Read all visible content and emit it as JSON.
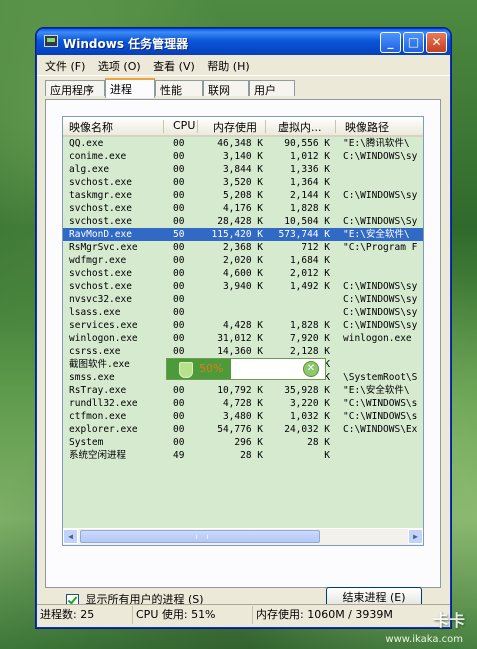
{
  "window": {
    "title": "Windows 任务管理器",
    "buttons": {
      "minimize": "_",
      "maximize": "□",
      "close": "✕"
    }
  },
  "menu": [
    {
      "label": "文件 (F)"
    },
    {
      "label": "选项 (O)"
    },
    {
      "label": "查看 (V)"
    },
    {
      "label": "帮助 (H)"
    }
  ],
  "tabs": [
    {
      "label": "应用程序",
      "active": false
    },
    {
      "label": "进程",
      "active": true
    },
    {
      "label": "性能",
      "active": false
    },
    {
      "label": "联网",
      "active": false
    },
    {
      "label": "用户",
      "active": false
    }
  ],
  "table": {
    "columns": [
      "映像名称",
      "CPU",
      "内存使用",
      "虚拟内...",
      "映像路径"
    ],
    "rows": [
      {
        "name": "QQ.exe",
        "cpu": "00",
        "mem": "46,348 K",
        "virt": "90,556 K",
        "path": "\"E:\\腾讯软件\\"
      },
      {
        "name": "conime.exe",
        "cpu": "00",
        "mem": "3,140 K",
        "virt": "1,012 K",
        "path": "C:\\WINDOWS\\sy"
      },
      {
        "name": "alg.exe",
        "cpu": "00",
        "mem": "3,844 K",
        "virt": "1,336 K",
        "path": ""
      },
      {
        "name": "svchost.exe",
        "cpu": "00",
        "mem": "3,520 K",
        "virt": "1,364 K",
        "path": ""
      },
      {
        "name": "taskmgr.exe",
        "cpu": "00",
        "mem": "5,208 K",
        "virt": "2,144 K",
        "path": "C:\\WINDOWS\\sy"
      },
      {
        "name": "svchost.exe",
        "cpu": "00",
        "mem": "4,176 K",
        "virt": "1,828 K",
        "path": ""
      },
      {
        "name": "svchost.exe",
        "cpu": "00",
        "mem": "28,428 K",
        "virt": "10,504 K",
        "path": "C:\\WINDOWS\\Sy"
      },
      {
        "name": "RavMonD.exe",
        "cpu": "50",
        "mem": "115,420 K",
        "virt": "573,744 K",
        "path": "\"E:\\安全软件\\",
        "selected": true
      },
      {
        "name": "RsMgrSvc.exe",
        "cpu": "00",
        "mem": "2,368 K",
        "virt": "712 K",
        "path": "\"C:\\Program F"
      },
      {
        "name": "wdfmgr.exe",
        "cpu": "00",
        "mem": "2,020 K",
        "virt": "1,684 K",
        "path": ""
      },
      {
        "name": "svchost.exe",
        "cpu": "00",
        "mem": "4,600 K",
        "virt": "2,012 K",
        "path": ""
      },
      {
        "name": "svchost.exe",
        "cpu": "00",
        "mem": "3,940 K",
        "virt": "1,492 K",
        "path": "C:\\WINDOWS\\sy"
      },
      {
        "name": "nvsvc32.exe",
        "cpu": "00",
        "mem": "",
        "virt": "",
        "path": "C:\\WINDOWS\\sy"
      },
      {
        "name": "lsass.exe",
        "cpu": "00",
        "mem": "",
        "virt": "",
        "path": "C:\\WINDOWS\\sy"
      },
      {
        "name": "services.exe",
        "cpu": "00",
        "mem": "4,428 K",
        "virt": "1,828 K",
        "path": "C:\\WINDOWS\\sy"
      },
      {
        "name": "winlogon.exe",
        "cpu": "00",
        "mem": "31,012 K",
        "virt": "7,920 K",
        "path": "winlogon.exe"
      },
      {
        "name": "csrss.exe",
        "cpu": "00",
        "mem": "14,360 K",
        "virt": "2,128 K",
        "path": ""
      },
      {
        "name": "截图软件.exe",
        "cpu": "01",
        "mem": "1,800 K",
        "virt": "6,268 K",
        "path": ""
      },
      {
        "name": "smss.exe",
        "cpu": "00",
        "mem": "808 K",
        "virt": "176 K",
        "path": "\\SystemRoot\\S"
      },
      {
        "name": "RsTray.exe",
        "cpu": "00",
        "mem": "10,792 K",
        "virt": "35,928 K",
        "path": "\"E:\\安全软件\\"
      },
      {
        "name": "rundll32.exe",
        "cpu": "00",
        "mem": "4,728 K",
        "virt": "3,220 K",
        "path": "\"C:\\WINDOWS\\s"
      },
      {
        "name": "ctfmon.exe",
        "cpu": "00",
        "mem": "3,480 K",
        "virt": "1,032 K",
        "path": "\"C:\\WINDOWS\\s"
      },
      {
        "name": "explorer.exe",
        "cpu": "00",
        "mem": "54,776 K",
        "virt": "24,032 K",
        "path": "C:\\WINDOWS\\Ex"
      },
      {
        "name": "System",
        "cpu": "00",
        "mem": "296 K",
        "virt": "28 K",
        "path": ""
      },
      {
        "name": "系统空闲进程",
        "cpu": "49",
        "mem": "28 K",
        "virt": "K",
        "path": ""
      }
    ]
  },
  "overlay": {
    "percent": "50%",
    "close": "✕"
  },
  "show_all_users": {
    "label": "显示所有用户的进程 (S)",
    "checked": true
  },
  "end_process_button": "结束进程 (E)",
  "status": {
    "processes": "进程数: 25",
    "cpu": "CPU 使用: 51%",
    "memory": "内存使用: 1060M / 3939M"
  },
  "watermark": {
    "brand": "卡卡",
    "url": "www.ikaka.com"
  }
}
